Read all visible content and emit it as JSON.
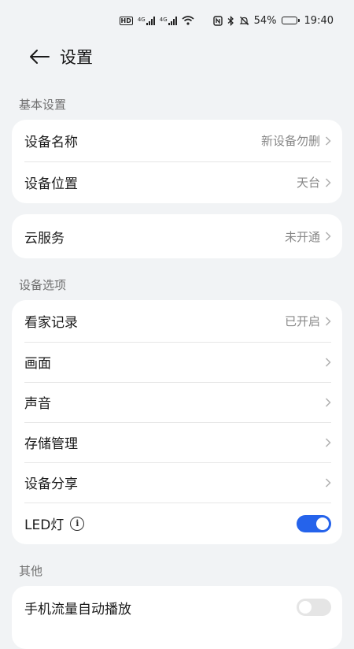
{
  "status_bar": {
    "hd": "HD",
    "network_1": "4G",
    "network_2": "4G",
    "battery_percent": "54%",
    "battery_level": 0.54,
    "time": "19:40",
    "icons": [
      "nfc-icon",
      "bluetooth-icon",
      "mute-bell-icon",
      "wifi-icon"
    ]
  },
  "header": {
    "title": "设置"
  },
  "sections": {
    "basic": {
      "label": "基本设置",
      "rows": [
        {
          "label": "设备名称",
          "value": "新设备勿删"
        },
        {
          "label": "设备位置",
          "value": "天台"
        }
      ]
    },
    "cloud": {
      "rows": [
        {
          "label": "云服务",
          "value": "未开通"
        }
      ]
    },
    "options": {
      "label": "设备选项",
      "rows": [
        {
          "label": "看家记录",
          "value": "已开启"
        },
        {
          "label": "画面",
          "value": ""
        },
        {
          "label": "声音",
          "value": ""
        },
        {
          "label": "存储管理",
          "value": ""
        },
        {
          "label": "设备分享",
          "value": ""
        }
      ],
      "led": {
        "label": "LED灯",
        "enabled": true
      }
    },
    "other": {
      "label": "其他",
      "mobile_autoplay": {
        "label": "手机流量自动播放",
        "enabled": false
      }
    }
  },
  "colors": {
    "accent": "#2563eb",
    "background": "#f1f3f5"
  }
}
